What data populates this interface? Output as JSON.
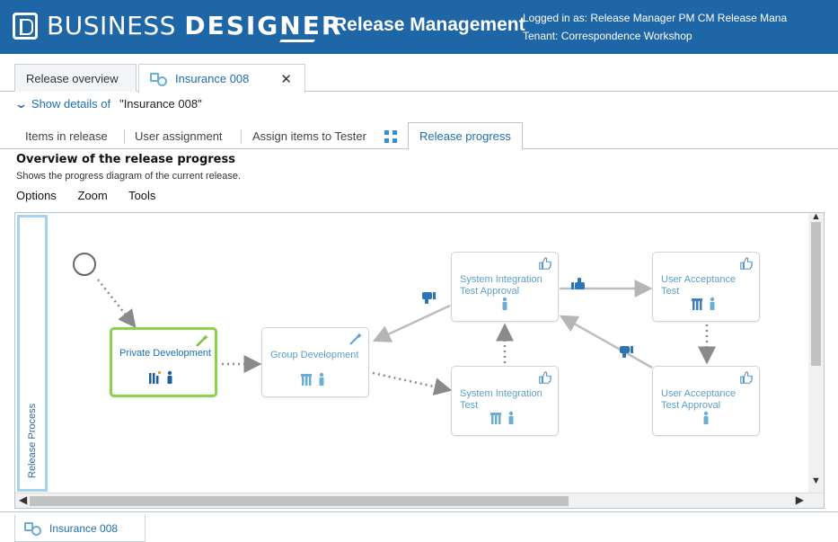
{
  "header": {
    "brand_light": "BUSINESS ",
    "brand_bold": "DESIGNER",
    "app_title": "Release Management",
    "login_text": "Logged in as:  Release Manager   PM CM Release Mana",
    "tenant_text": "Tenant:  Correspondence Workshop",
    "background_color": "#1f66a6"
  },
  "doc_tabs": [
    {
      "label": "Release overview",
      "active": false
    },
    {
      "label": "Insurance 008",
      "active": true,
      "icon": "release-icon",
      "closable": true
    }
  ],
  "details": {
    "toggle_label": "Show details of",
    "item_name": "\"Insurance 008\""
  },
  "sub_tabs": [
    {
      "label": "Items in release"
    },
    {
      "label": "User assignment"
    },
    {
      "label": "Assign items to Tester"
    },
    {
      "label": "Release progress",
      "active": true
    }
  ],
  "section": {
    "title": "Overview of the release progress",
    "description": "Shows the progress diagram of the current release."
  },
  "menu": [
    "Options",
    "Zoom",
    "Tools"
  ],
  "diagram": {
    "lane_label": "Release Process",
    "nodes": [
      {
        "id": "private-development",
        "label": "Private Development",
        "active": true
      },
      {
        "id": "group-development",
        "label": "Group Development"
      },
      {
        "id": "system-integration-test-approval",
        "label": "System Integration Test Approval"
      },
      {
        "id": "system-integration-test",
        "label": "System Integration Test"
      },
      {
        "id": "user-acceptance-test",
        "label": "User Acceptance Test"
      },
      {
        "id": "user-acceptance-test-approval",
        "label": "User Acceptance Test Approval"
      }
    ],
    "accent_active": "#8cd14a",
    "node_text_color": "#5e9ec8"
  },
  "bottom_tab": {
    "label": "Insurance 008",
    "icon": "release-icon"
  }
}
